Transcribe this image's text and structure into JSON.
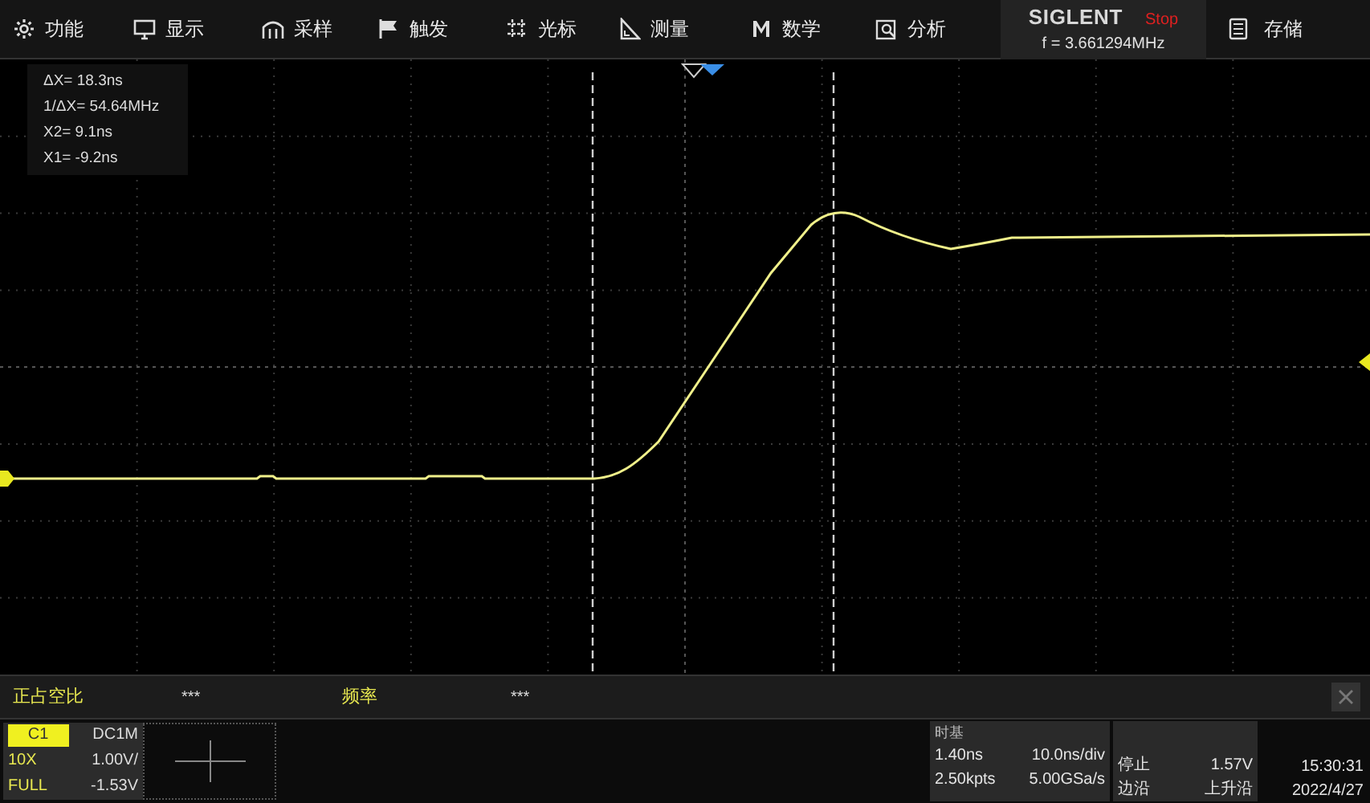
{
  "menu": [
    {
      "label": "功能"
    },
    {
      "label": "显示"
    },
    {
      "label": "采样"
    },
    {
      "label": "触发"
    },
    {
      "label": "光标"
    },
    {
      "label": "测量"
    },
    {
      "label": "数学"
    },
    {
      "label": "分析"
    }
  ],
  "status": {
    "brand": "SIGLENT",
    "run_state": "Stop",
    "frequency": "f = 3.661294MHz"
  },
  "save_menu": {
    "label": "存储"
  },
  "cursor_readout": [
    "ΔX= 18.3ns",
    "1/ΔX= 54.64MHz",
    "X2= 9.1ns",
    "X1= -9.2ns"
  ],
  "measurements": [
    {
      "label": "正占空比",
      "value": "***"
    },
    {
      "label": "频率",
      "value": "***"
    }
  ],
  "channel": {
    "name": "C1",
    "coupling": "DC1M",
    "probe": "10X",
    "scale": "1.00V/",
    "bandwidth": "FULL",
    "offset": "-1.53V"
  },
  "timebase": {
    "title": "时基",
    "delay": "1.40ns",
    "scale": "10.0ns/div",
    "memory": "2.50kpts",
    "sample_rate": "5.00GSa/s"
  },
  "trigger": {
    "state": "停止",
    "level": "1.57V",
    "type": "边沿",
    "slope": "上升沿"
  },
  "clock": {
    "time": "15:30:31",
    "date": "2022/4/27"
  }
}
